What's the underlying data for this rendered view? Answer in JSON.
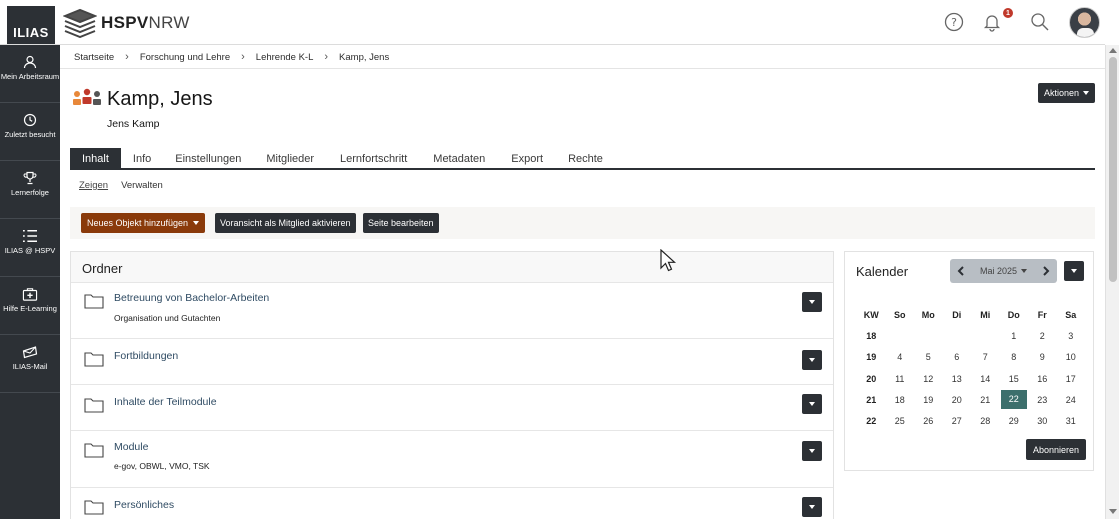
{
  "header": {
    "ilias_logo": "ILIAS",
    "brand_bold": "HSPV",
    "brand_light": "NRW",
    "notification_count": "1"
  },
  "leftnav": {
    "items": [
      {
        "label": "Mein Arbeitsraum",
        "icon": "user-icon"
      },
      {
        "label": "Zuletzt besucht",
        "icon": "clock-icon"
      },
      {
        "label": "Lernerfolge",
        "icon": "trophy-icon"
      },
      {
        "label": "ILIAS @ HSPV",
        "icon": "list-icon"
      },
      {
        "label": "Hilfe E-Learning",
        "icon": "first-aid-icon"
      },
      {
        "label": "ILIAS-Mail",
        "icon": "mail-icon"
      }
    ]
  },
  "breadcrumb": [
    "Startseite",
    "Forschung und Lehre",
    "Lehrende K-L",
    "Kamp, Jens"
  ],
  "page": {
    "title": "Kamp, Jens",
    "subtitle": "Jens Kamp",
    "actions_label": "Aktionen"
  },
  "tabs": [
    "Inhalt",
    "Info",
    "Einstellungen",
    "Mitglieder",
    "Lernfortschritt",
    "Metadaten",
    "Export",
    "Rechte"
  ],
  "subtabs": [
    "Zeigen",
    "Verwalten"
  ],
  "toolbar": {
    "add_label": "Neues Objekt hinzufügen",
    "preview_label": "Voransicht als Mitglied aktivieren",
    "edit_label": "Seite bearbeiten"
  },
  "ordner": {
    "heading": "Ordner",
    "items": [
      {
        "title": "Betreuung von Bachelor-Arbeiten",
        "desc": "Organisation und Gutachten"
      },
      {
        "title": "Fortbildungen",
        "desc": ""
      },
      {
        "title": "Inhalte der Teilmodule",
        "desc": ""
      },
      {
        "title": "Module",
        "desc": "e-gov, OBWL, VMO, TSK"
      },
      {
        "title": "Persönliches",
        "desc": ""
      }
    ]
  },
  "calendar": {
    "title": "Kalender",
    "month": "Mai 2025",
    "weekday_headers": [
      "KW",
      "So",
      "Mo",
      "Di",
      "Mi",
      "Do",
      "Fr",
      "Sa"
    ],
    "weeks": [
      [
        "18",
        "",
        "",
        "",
        "",
        "1",
        "2",
        "3"
      ],
      [
        "19",
        "4",
        "5",
        "6",
        "7",
        "8",
        "9",
        "10"
      ],
      [
        "20",
        "11",
        "12",
        "13",
        "14",
        "15",
        "16",
        "17"
      ],
      [
        "21",
        "18",
        "19",
        "20",
        "21",
        "22",
        "23",
        "24"
      ],
      [
        "22",
        "25",
        "26",
        "27",
        "28",
        "29",
        "30",
        "31"
      ]
    ],
    "today": "22",
    "subscribe_label": "Abonnieren"
  }
}
